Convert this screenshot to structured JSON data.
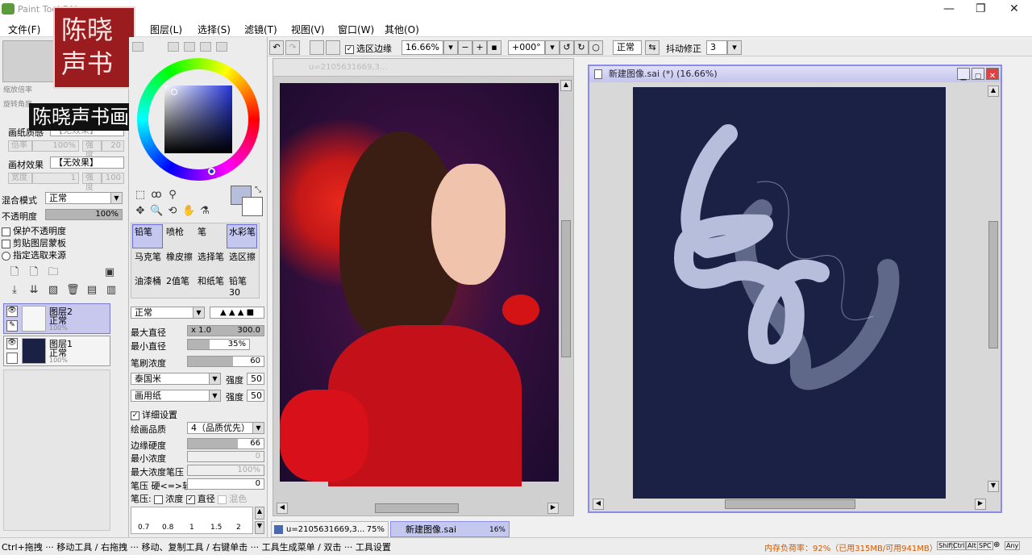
{
  "app": {
    "title": "Paint Tool SAI"
  },
  "menu": [
    "文件(F)",
    "图层(L)",
    "选择(S)",
    "滤镜(T)",
    "视图(V)",
    "窗口(W)",
    "其他(O)"
  ],
  "window_controls": {
    "min": "—",
    "max": "❐",
    "close": "✕"
  },
  "watermark": {
    "seal_text": "陈晓声书画",
    "caption": "陈晓声书画"
  },
  "toolbar": {
    "selection_edge_label": "选区边缘",
    "zoom": "16.66%",
    "rotation": "+000°",
    "blend": "正常",
    "stabilizer_label": "抖动修正",
    "stabilizer_value": "3"
  },
  "navigator": {
    "zoom_label": "缩放倍率",
    "rotate_label": "旋转角度",
    "zoom_value": "",
    "rotate_value": ""
  },
  "texture": {
    "paper_label": "画纸质感",
    "paper_value": "【无效果】",
    "scale_label": "倍率",
    "scale_value": "100%",
    "strength_label": "强度",
    "strength_value": "20",
    "material_label": "画材效果",
    "material_value": "【无效果】",
    "width_label": "宽度",
    "width_value": "1",
    "str2_label": "强度",
    "str2_value": "100"
  },
  "layer_props": {
    "blend_label": "混合模式",
    "blend_value": "正常",
    "opacity_label": "不透明度",
    "opacity_value": "100%",
    "opacity_fraction": 1.0,
    "protect_opacity": "保护不透明度",
    "clip_group": "剪贴图层蒙板",
    "selection_source": "指定选取来源"
  },
  "layers": [
    {
      "name": "图层2",
      "mode": "正常",
      "opacity": "100%",
      "selected": true
    },
    {
      "name": "图层1",
      "mode": "正常",
      "opacity": "100%",
      "selected": false
    }
  ],
  "brushes": [
    [
      "铅笔",
      "喷枪",
      "笔",
      "水彩笔"
    ],
    [
      "马克笔",
      "橡皮擦",
      "选择笔",
      "选区擦"
    ],
    [
      "油漆桶",
      "2值笔",
      "和纸笔",
      "铅笔30"
    ]
  ],
  "brush_settings": {
    "mode": "正常",
    "max_size_label": "最大直径",
    "max_size_multiplier": "x 1.0",
    "max_size_value": "300.0",
    "min_size_label": "最小直径",
    "min_size_value": "35%",
    "min_size_fraction": 0.35,
    "density_label": "笔刷浓度",
    "density_value": "60",
    "density_fraction": 0.6,
    "shape1": "泰国米",
    "shape1_strength_label": "强度",
    "shape1_strength": "50",
    "shape2": "画用纸",
    "shape2_strength_label": "强度",
    "shape2_strength": "50",
    "advanced_label": "详细设置",
    "quality_label": "绘画品质",
    "quality_value": "4（品质优先）",
    "edge_label": "边缘硬度",
    "edge_value": "66",
    "edge_fraction": 0.66,
    "min_density_label": "最小浓度",
    "min_density_value": "0",
    "max_density_pressure_label": "最大浓度笔压",
    "max_density_pressure_value": "100%",
    "pressure_label": "笔压 硬<=>软",
    "pressure_value": "0",
    "pressure2_label": "笔压:",
    "pressure_density": "浓度",
    "pressure_size": "直径",
    "pressure_blend": "混色",
    "size_presets": [
      "0.7",
      "0.8",
      "1",
      "1.5",
      "2"
    ]
  },
  "doc1": {
    "title": "u=2105631669,3...",
    "zoom": "75%"
  },
  "doc2": {
    "title": "新建图像.sai (*) (16.66%)",
    "tab": "新建图像.sai",
    "zoom": "16%"
  },
  "status": {
    "hint": "Ctrl+拖拽 ··· 移动工具 / 右拖拽 ··· 移动、复制工具 / 右键单击 ··· 工具生成菜单 / 双击 ··· 工具设置",
    "memory": "内存负荷率：92%（已用315MB/可用941MB）",
    "keys": [
      "Shift",
      "Ctrl",
      "Alt",
      "SPC",
      "⊕",
      "Any"
    ]
  },
  "colors": {
    "accent": "#8c8ce6",
    "canvas_bg": "#1a2145",
    "stroke": "#b6bedc"
  }
}
